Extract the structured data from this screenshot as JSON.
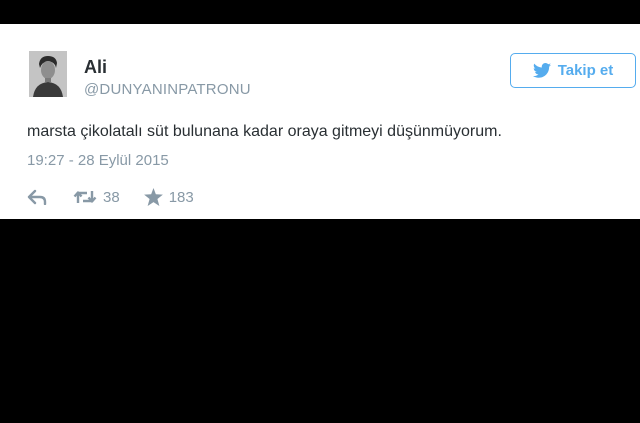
{
  "tweet": {
    "author": {
      "display_name": "Ali",
      "screen_name": "@DUNYANINPATRONU"
    },
    "follow_button": {
      "label": "Takip et",
      "icon": "twitter-bird-icon"
    },
    "text": "marsta çikolatalı süt bulunana kadar oraya gitmeyi düşünmüyorum.",
    "timestamp": "19:27 - 28 Eylül 2015",
    "actions": {
      "reply": {
        "icon": "reply-icon"
      },
      "retweet": {
        "icon": "retweet-icon",
        "count": "38"
      },
      "favorite": {
        "icon": "star-icon",
        "count": "183"
      }
    }
  },
  "colors": {
    "background": "#000000",
    "card": "#ffffff",
    "accent": "#55acee",
    "text": "#292f33",
    "muted": "#8899a6"
  }
}
